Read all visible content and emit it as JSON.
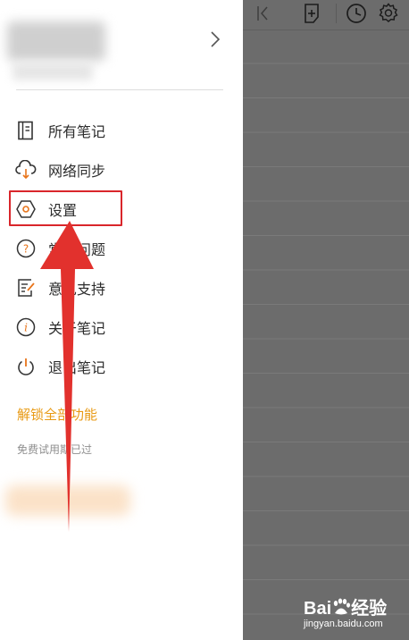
{
  "drawer": {
    "profile": {
      "chevron_icon": "chevron-right-icon"
    },
    "menu": [
      {
        "label": "所有笔记",
        "icon": "notebook-icon"
      },
      {
        "label": "网络同步",
        "icon": "cloud-sync-icon"
      },
      {
        "label": "设置",
        "icon": "hexagon-settings-icon"
      },
      {
        "label": "常见问题",
        "icon": "question-circle-icon"
      },
      {
        "label": "意见支持",
        "icon": "feedback-icon"
      },
      {
        "label": "关于笔记",
        "icon": "info-circle-icon"
      },
      {
        "label": "退出笔记",
        "icon": "power-icon"
      }
    ],
    "unlock_link": "解锁全部功能",
    "trial_text": "免费试用期已过"
  },
  "toolbar": {
    "icons": [
      "panel-collapse-icon",
      "new-note-icon",
      "clock-icon",
      "gear-icon"
    ]
  },
  "watermark": {
    "logo_left": "Bai",
    "logo_right": "经验",
    "site": "jingyan.baidu.com"
  },
  "colors": {
    "accent_orange": "#e89a14",
    "highlight_red": "#d9262b",
    "overlay_gray": "#6c6c6c"
  }
}
